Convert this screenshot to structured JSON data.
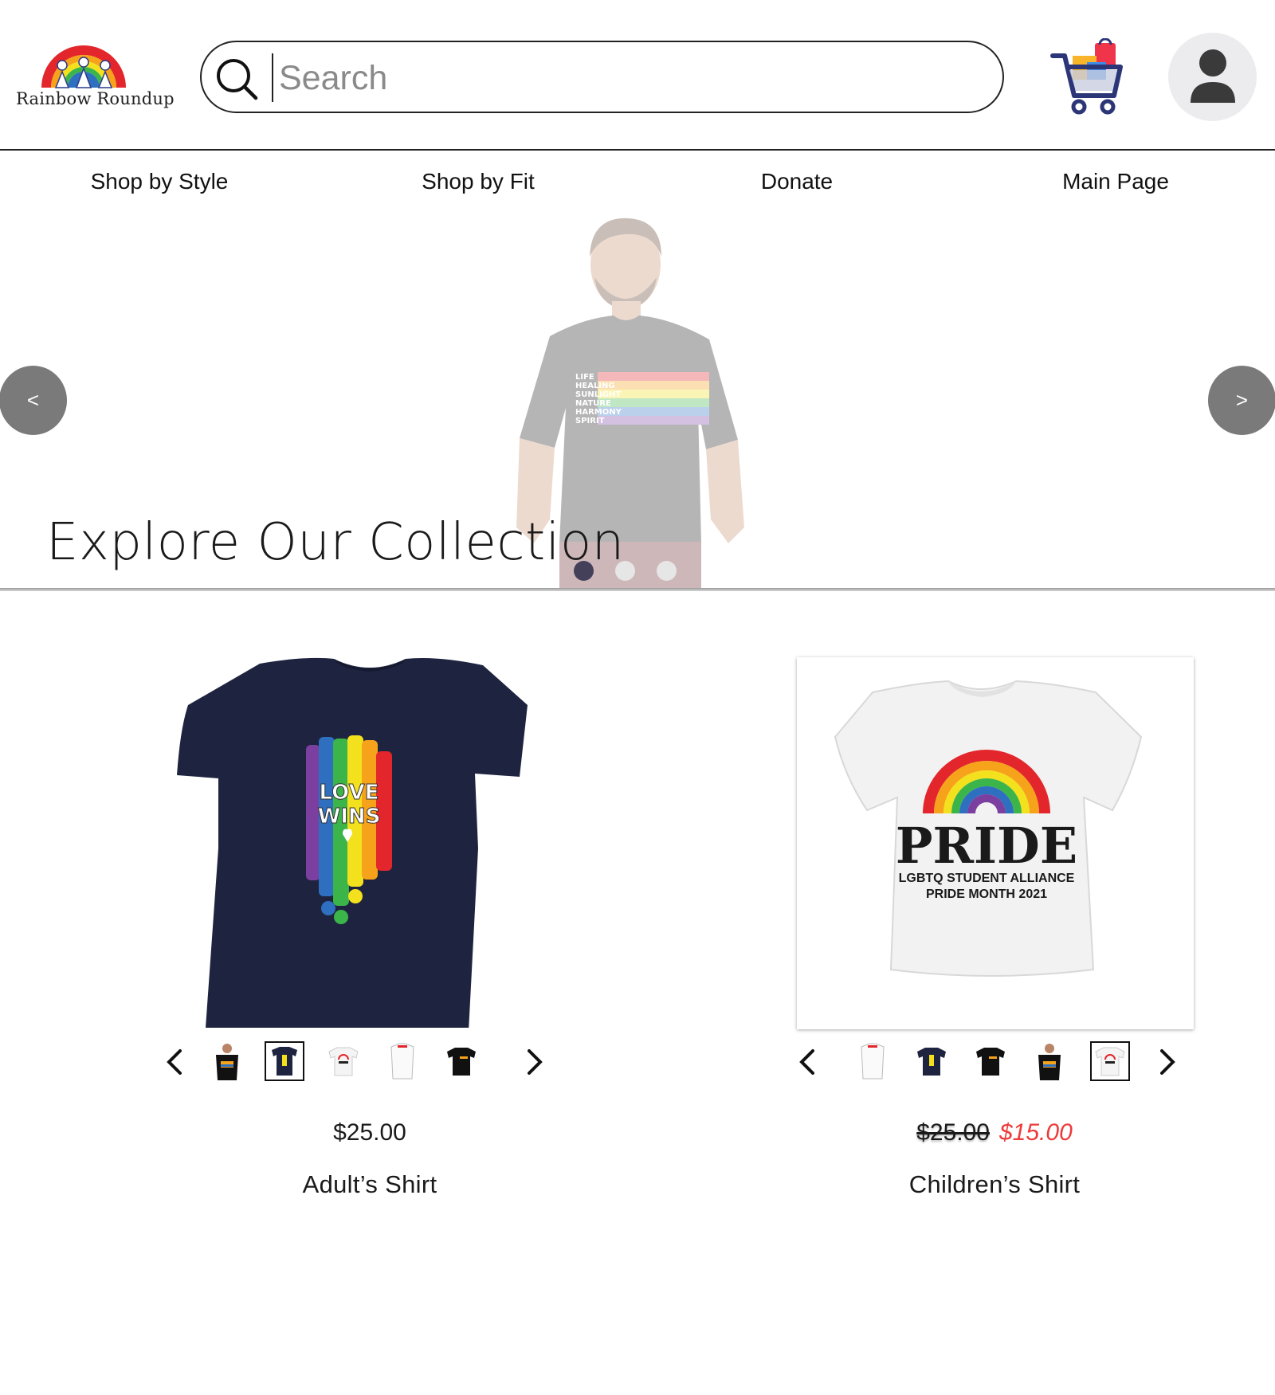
{
  "header": {
    "brand_name": "Rainbow Roundup",
    "search_placeholder": "Search",
    "search_value": ""
  },
  "nav": {
    "items": [
      {
        "label": "Shop by Style"
      },
      {
        "label": "Shop by Fit"
      },
      {
        "label": "Donate"
      },
      {
        "label": "Main Page"
      }
    ]
  },
  "hero": {
    "title": "Explore Our Collection",
    "prev_label": "<",
    "next_label": ">",
    "active_slide": 1,
    "slide_count": 3,
    "shirt_words": [
      "LIFE",
      "HEALING",
      "SUNLIGHT",
      "NATURE",
      "HARMONY",
      "SPIRIT"
    ]
  },
  "products": [
    {
      "name": "Adult’s Shirt",
      "price": "$25.00",
      "shirt_text": [
        "LOVE",
        "WINS"
      ],
      "selected_thumb": 2,
      "thumb_count": 5
    },
    {
      "name": "Children’s Shirt",
      "original_price": "$25.00",
      "sale_price": "$15.00",
      "shirt_title": "PRIDE",
      "shirt_line1": "LGBTQ STUDENT ALLIANCE",
      "shirt_line2": "PRIDE MONTH 2021",
      "selected_thumb": 5,
      "thumb_count": 5
    }
  ],
  "colors": {
    "sale_red": "#ee3a3a",
    "carousel_button": "#7a7a7a",
    "active_dot": "#44405a",
    "navy_shirt": "#1e2440"
  }
}
